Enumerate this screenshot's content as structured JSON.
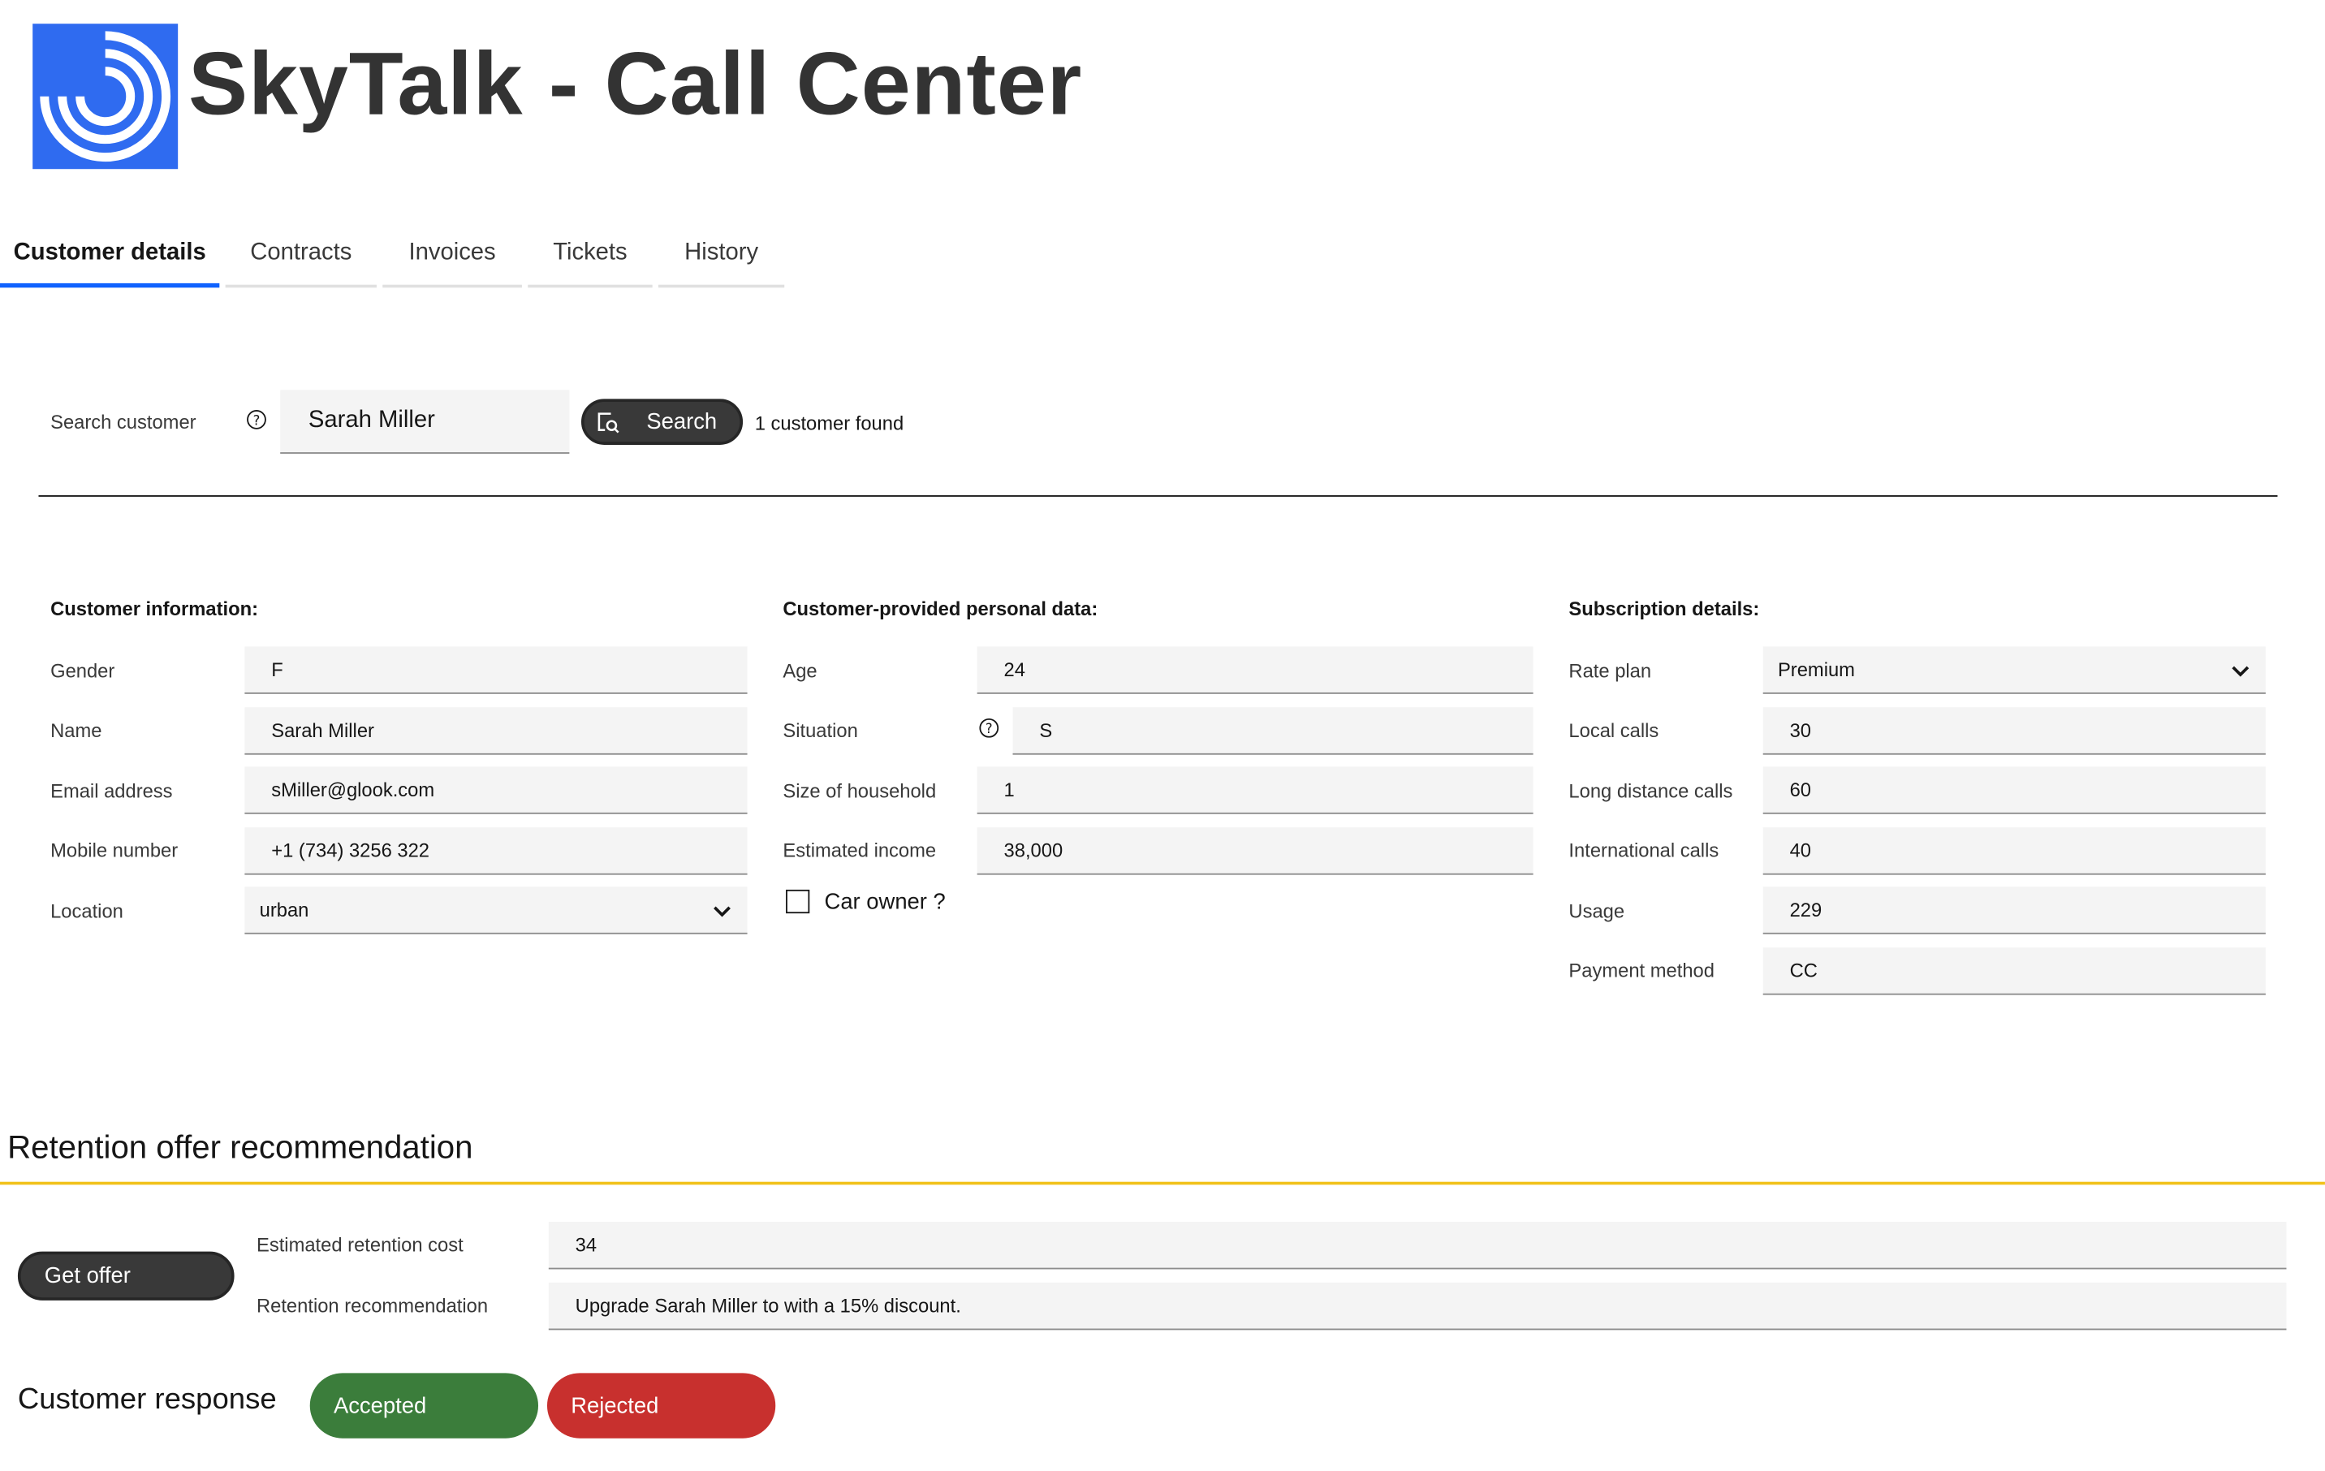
{
  "app": {
    "title": "SkyTalk - Call Center"
  },
  "tabs": [
    {
      "label": "Customer details",
      "active": true
    },
    {
      "label": "Contracts",
      "active": false
    },
    {
      "label": "Invoices",
      "active": false
    },
    {
      "label": "Tickets",
      "active": false
    },
    {
      "label": "History",
      "active": false
    }
  ],
  "search": {
    "label": "Search customer",
    "value": "Sarah Miller",
    "button_label": "Search",
    "result_text": "1 customer found"
  },
  "customer_info": {
    "heading": "Customer information:",
    "gender_label": "Gender",
    "gender": "F",
    "name_label": "Name",
    "name": "Sarah Miller",
    "email_label": "Email address",
    "email": "sMiller@glook.com",
    "mobile_label": "Mobile number",
    "mobile": "+1 (734) 3256 322",
    "location_label": "Location",
    "location": "urban"
  },
  "personal_data": {
    "heading": "Customer-provided personal data:",
    "age_label": "Age",
    "age": "24",
    "situation_label": "Situation",
    "situation": "S",
    "household_label": "Size of household",
    "household": "1",
    "income_label": "Estimated income",
    "income": "38,000",
    "car_owner_label": "Car owner ?",
    "car_owner_checked": false
  },
  "subscription": {
    "heading": "Subscription details:",
    "rate_plan_label": "Rate plan",
    "rate_plan": "Premium",
    "local_calls_label": "Local calls",
    "local_calls": "30",
    "long_distance_label": "Long distance calls",
    "long_distance": "60",
    "international_label": "International calls",
    "international": "40",
    "usage_label": "Usage",
    "usage": "229",
    "payment_label": "Payment method",
    "payment": "CC"
  },
  "retention": {
    "heading": "Retention offer recommendation",
    "get_offer_label": "Get offer",
    "cost_label": "Estimated retention cost",
    "cost": "34",
    "recommendation_label": "Retention recommendation",
    "recommendation": "Upgrade Sarah Miller to  with a 15% discount."
  },
  "response": {
    "label": "Customer response",
    "accepted_label": "Accepted",
    "rejected_label": "Rejected"
  },
  "colors": {
    "brand_blue": "#2f6bf0",
    "tab_active": "#0f62fe",
    "accent_yellow": "#f1c21b",
    "accepted_green": "#3b7d3b",
    "rejected_red": "#c8302e",
    "button_dark": "#393939"
  }
}
